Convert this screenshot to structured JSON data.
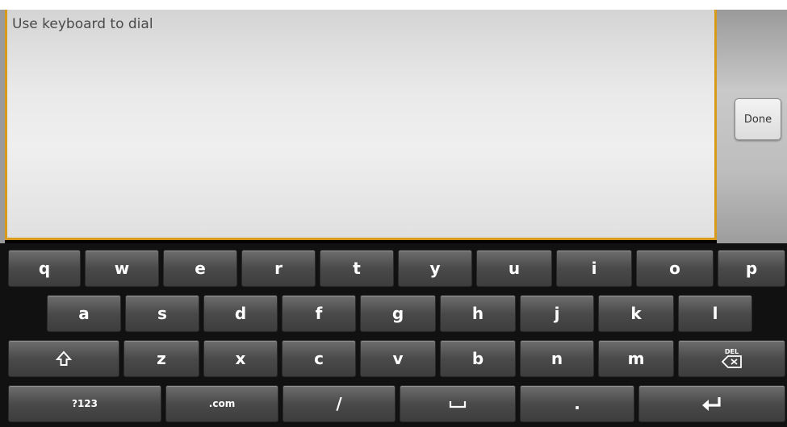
{
  "dial_field": {
    "hint": "Use keyboard to dial"
  },
  "side_panel": {
    "done_label": "Done"
  },
  "keyboard": {
    "row1": [
      "q",
      "w",
      "e",
      "r",
      "t",
      "y",
      "u",
      "i",
      "o",
      "p"
    ],
    "row2": [
      "a",
      "s",
      "d",
      "f",
      "g",
      "h",
      "j",
      "k",
      "l"
    ],
    "row3": {
      "shift_icon": "shift-arrow-icon",
      "letters": [
        "z",
        "x",
        "c",
        "v",
        "b",
        "n",
        "m"
      ],
      "delete_label": "DEL"
    },
    "row4": {
      "symbols_label": "?123",
      "dotcom_label": ".com",
      "slash_label": "/",
      "space_icon": "space-bar-icon",
      "period_label": ".",
      "enter_icon": "enter-return-icon"
    }
  }
}
